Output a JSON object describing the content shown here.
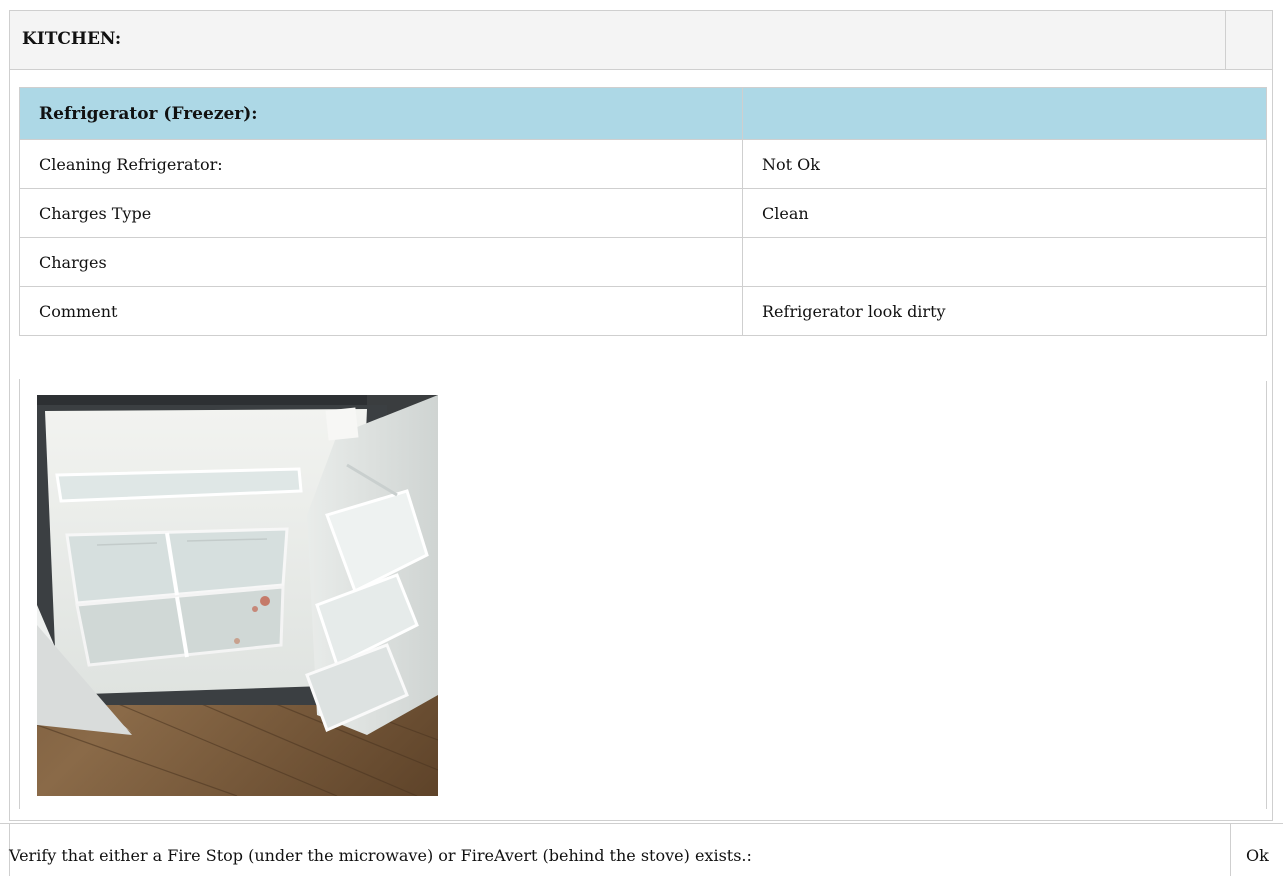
{
  "section": {
    "title": "KITCHEN:"
  },
  "subsection": {
    "title": "Refrigerator (Freezer):",
    "header_value": "",
    "rows": [
      {
        "label": "Cleaning Refrigerator:",
        "value": "Not Ok"
      },
      {
        "label": "Charges Type",
        "value": "Clean"
      },
      {
        "label": "Charges",
        "value": ""
      },
      {
        "label": "Comment",
        "value": "Refrigerator look dirty"
      }
    ]
  },
  "next_item": {
    "label": "Verify that either a Fire Stop (under the microwave) or FireAvert (behind the stove) exists.:",
    "value": "Ok"
  },
  "colors": {
    "header_band": "#f4f4f4",
    "subheader_band": "#add8e6",
    "border": "#cfcfcf"
  }
}
